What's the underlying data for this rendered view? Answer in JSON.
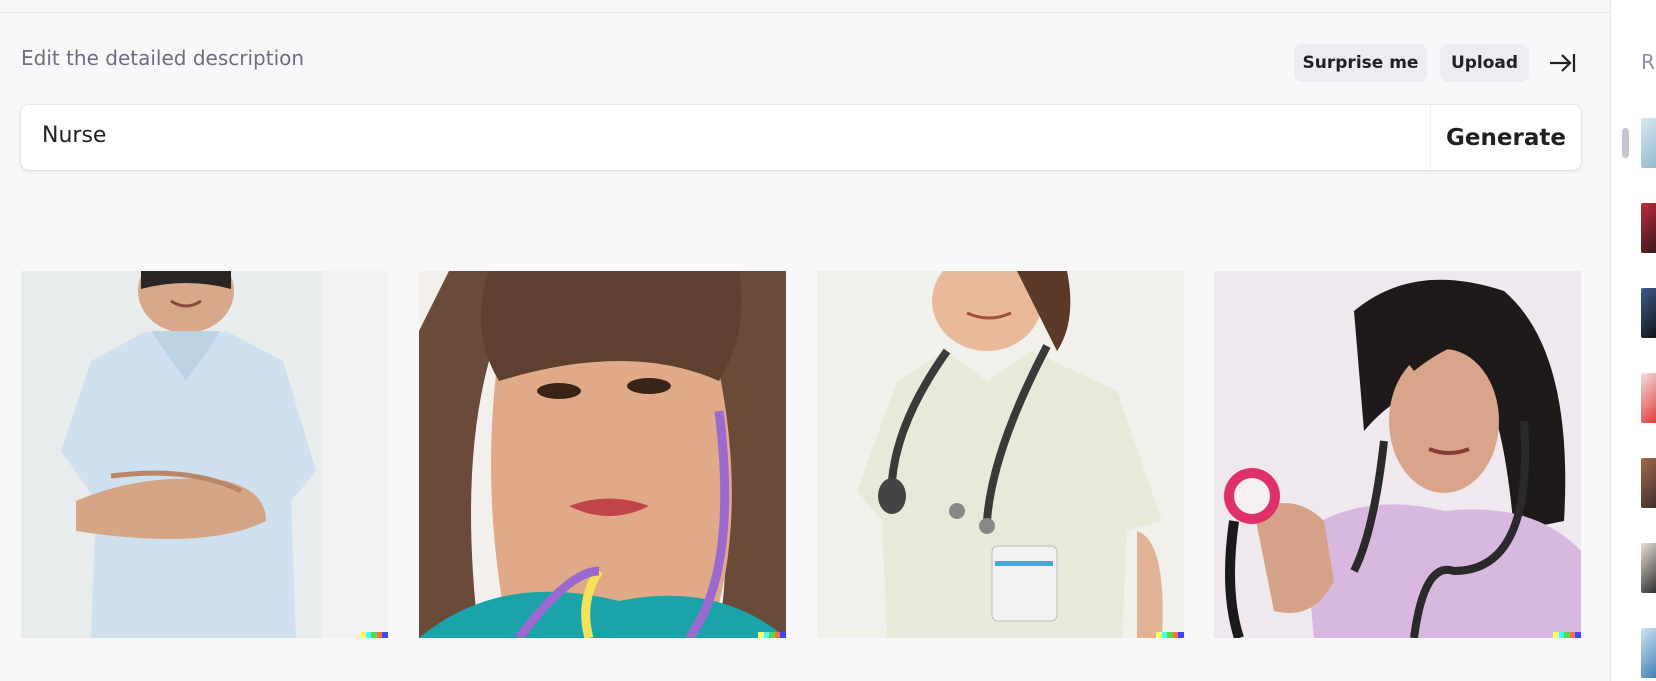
{
  "header": {
    "description_label": "Edit the detailed description",
    "surprise_label": "Surprise me",
    "upload_label": "Upload"
  },
  "prompt": {
    "value": "Nurse",
    "generate_label": "Generate"
  },
  "results": [
    {
      "subject": "man in light blue scrubs with crossed arms"
    },
    {
      "subject": "woman with bangs wearing teal scrubs and purple stethoscope"
    },
    {
      "subject": "woman in pale green scrubs with stethoscope"
    },
    {
      "subject": "woman in pink scrubs holding stethoscope"
    }
  ],
  "sidebar": {
    "title": "R"
  }
}
